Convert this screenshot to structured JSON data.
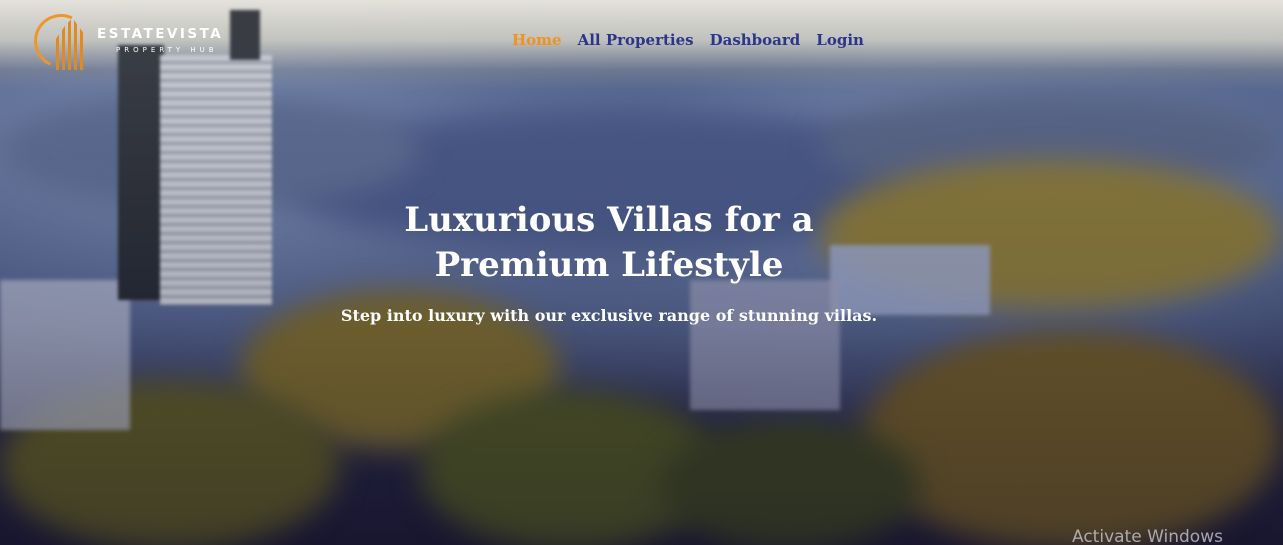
{
  "brand": {
    "name": "ESTATEVISTA",
    "tagline": "PROPERTY HUB"
  },
  "nav": {
    "items": [
      {
        "label": "Home",
        "active": true
      },
      {
        "label": "All Properties",
        "active": false
      },
      {
        "label": "Dashboard",
        "active": false
      },
      {
        "label": "Login",
        "active": false
      }
    ]
  },
  "hero": {
    "title_line1": "Luxurious Villas for a",
    "title_line2": "Premium Lifestyle",
    "subtitle": "Step into luxury with our exclusive range of stunning villas."
  },
  "system": {
    "watermark": "Activate Windows"
  },
  "colors": {
    "nav_link": "#2b3589",
    "nav_active": "#f39219",
    "logo_accent": "#f0952a"
  }
}
